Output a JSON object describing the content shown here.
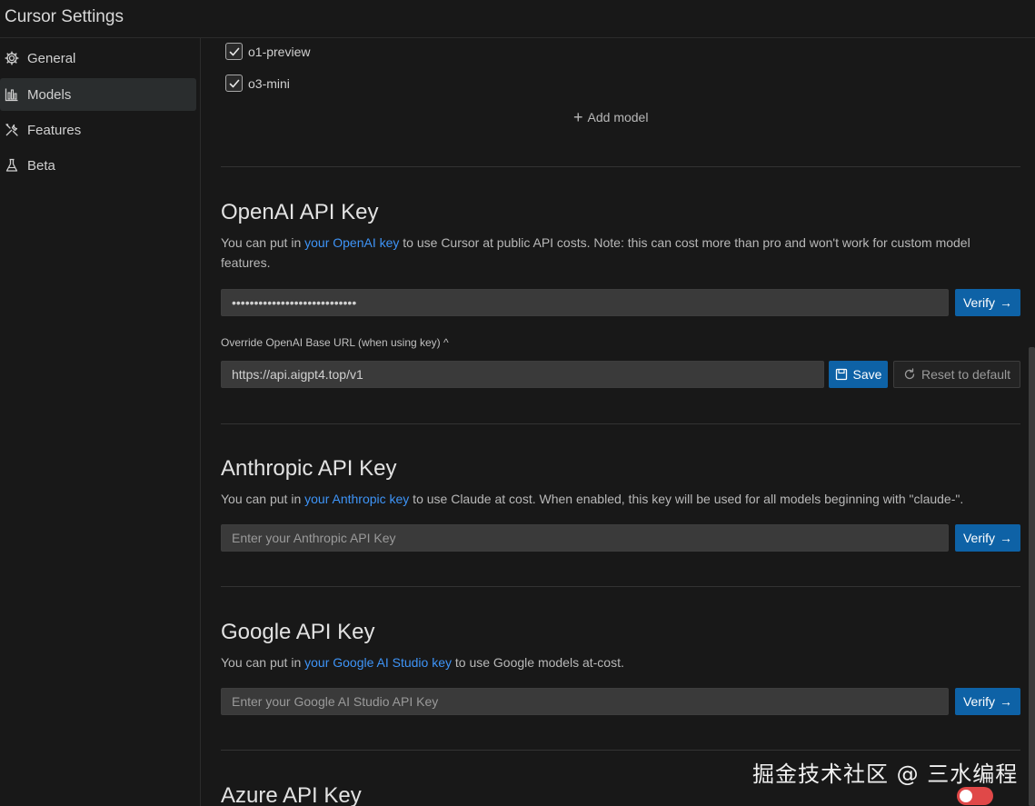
{
  "window": {
    "title": "Cursor Settings"
  },
  "sidebar": {
    "items": [
      {
        "label": "General",
        "icon": "gear-icon"
      },
      {
        "label": "Models",
        "icon": "bar-chart-icon",
        "active": true
      },
      {
        "label": "Features",
        "icon": "tools-icon"
      },
      {
        "label": "Beta",
        "icon": "flask-icon"
      }
    ]
  },
  "models": {
    "items": [
      {
        "label": "o1-preview",
        "checked": true
      },
      {
        "label": "o3-mini",
        "checked": true
      }
    ],
    "add_label": "Add model"
  },
  "openai": {
    "title": "OpenAI API Key",
    "desc_pre": "You can put in ",
    "desc_link": "your OpenAI key",
    "desc_post": " to use Cursor at public API costs. Note: this can cost more than pro and won't work for custom model features.",
    "key_value": "••••••••••••••••••••••••••••",
    "verify_label": "Verify",
    "override_label": "Override OpenAI Base URL (when using key) ^",
    "base_url": "https://api.aigpt4.top/v1",
    "save_label": "Save",
    "reset_label": "Reset to default"
  },
  "anthropic": {
    "title": "Anthropic API Key",
    "desc_pre": "You can put in ",
    "desc_link": "your Anthropic key",
    "desc_post": " to use Claude at cost. When enabled, this key will be used for all models beginning with \"claude-\".",
    "placeholder": "Enter your Anthropic API Key",
    "verify_label": "Verify"
  },
  "google": {
    "title": "Google API Key",
    "desc_pre": "You can put in ",
    "desc_link": "your Google AI Studio key",
    "desc_post": " to use Google models at-cost.",
    "placeholder": "Enter your Google AI Studio API Key",
    "verify_label": "Verify"
  },
  "azure": {
    "title": "Azure API Key",
    "enabled": false
  },
  "watermark": "掘金技术社区 @ 三水编程",
  "colors": {
    "accent": "#0e62a6",
    "link": "#3e94f7",
    "toggle_off": "#e04848"
  }
}
